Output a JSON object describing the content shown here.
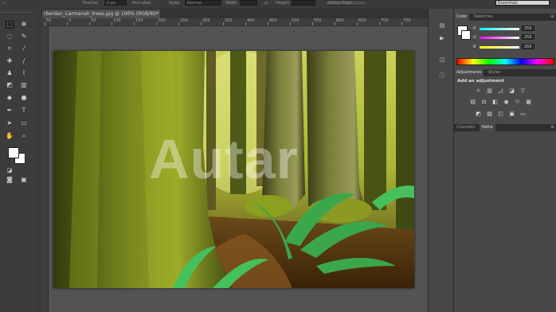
{
  "options_bar": {
    "feather_label": "Feather:",
    "feather_value": "0 px",
    "anti_alias_label": "Anti-alias",
    "style_label": "Style:",
    "style_value": "Normal",
    "width_label": "Width:",
    "height_label": "Height:",
    "refine_edge_label": "Refine Edge...",
    "workspace_value": "Essentials"
  },
  "document": {
    "tab_title": "rberdan_Carmanah_trees.jpg @ 100% (RGB/8) *",
    "ruler_marks": [
      "50",
      "0",
      "50",
      "100",
      "150",
      "200",
      "250",
      "300",
      "350",
      "400",
      "450",
      "500",
      "550",
      "600",
      "650",
      "700",
      "750"
    ]
  },
  "watermark": "Autar",
  "color_panel": {
    "tabs": [
      "Color",
      "Swatches"
    ],
    "channels": [
      {
        "name": "R",
        "value": "255"
      },
      {
        "name": "G",
        "value": "255"
      },
      {
        "name": "B",
        "value": "255"
      }
    ]
  },
  "adjustments_panel": {
    "tabs": [
      "Adjustments",
      "Styles"
    ],
    "heading": "Add an adjustment"
  },
  "channels_panel": {
    "tabs": [
      "Channels",
      "Paths"
    ]
  },
  "colors": {
    "foreground": "#ffffff",
    "background": "#ffffff"
  }
}
